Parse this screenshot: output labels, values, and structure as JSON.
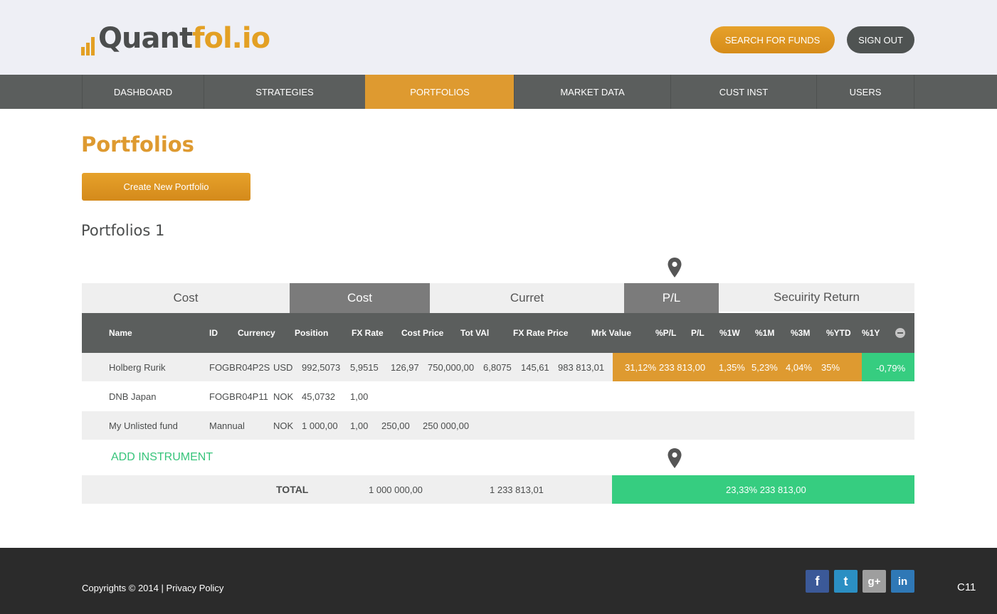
{
  "header": {
    "logo_dark": "Quant",
    "logo_orange": "fol.io",
    "search_button": "SEARCH FOR FUNDS",
    "signout_button": "SIGN OUT"
  },
  "nav": {
    "items": [
      {
        "label": "DASHBOARD"
      },
      {
        "label": "STRATEGIES"
      },
      {
        "label": "PORTFOLIOS"
      },
      {
        "label": "MARKET DATA"
      },
      {
        "label": "CUST INST"
      },
      {
        "label": "USERS"
      }
    ],
    "active": "PORTFOLIOS"
  },
  "page": {
    "title": "Portfolios",
    "create_button": "Create New Portfolio",
    "section_title": "Portfolios 1"
  },
  "groups": [
    "Cost",
    "Cost",
    "Curret",
    "P/L",
    "Secuirity Return"
  ],
  "columns": [
    "Name",
    "ID",
    "Currency",
    "Position",
    "FX Rate",
    "Cost Price",
    "Tot VAl",
    "FX Rate Price",
    "Mrk Value",
    "%P/L",
    "P/L",
    "%1W",
    "%1M",
    "%3M",
    "%YTD",
    "%1Y"
  ],
  "rows": [
    {
      "name": "Holberg Rurik",
      "id": "FOGBR04P2S",
      "currency": "USD",
      "position": "992,5073",
      "fx_rate": "5,9515",
      "cost_price": "126,97",
      "tot_val": "750,000,00",
      "fx_rate_price": "6,8075",
      "price": "145,61",
      "mrk_value": "983 813,01",
      "pct_pl": "31,12%",
      "pl": "233 813,00",
      "pct_1w": "1,35%",
      "pct_1m": "5,23%",
      "pct_3m": "4,04%",
      "pct_ytd": "35%",
      "pct_1y": "-0,79%"
    },
    {
      "name": "DNB Japan",
      "id": "FOGBR04P11",
      "currency": "NOK",
      "position": "45,0732",
      "fx_rate": "1,00"
    },
    {
      "name": "My Unlisted fund",
      "id": "Mannual",
      "currency": "NOK",
      "position": "1 000,00",
      "fx_rate": "1,00",
      "cost_price": "250,00",
      "tot_val": "250 000,00"
    }
  ],
  "add_instrument": "ADD INSTRUMENT",
  "total": {
    "label": "TOTAL",
    "cost": "1 000 000,00",
    "current": "1 233 813,01",
    "pl": "23,33% 233 813,00"
  },
  "footer": {
    "copyright": "Copyrights © 2014 | Privacy Policy",
    "code": "C11",
    "social": [
      {
        "icon": "facebook-icon",
        "glyph": "f",
        "color": "#3b5998"
      },
      {
        "icon": "twitter-icon",
        "glyph": "t",
        "color": "#2b8fc3"
      },
      {
        "icon": "google-plus-icon",
        "glyph": "g+",
        "color": "#9e9e9e"
      },
      {
        "icon": "linkedin-icon",
        "glyph": "in",
        "color": "#2f78b6"
      }
    ]
  },
  "colors": {
    "brand_orange": "#de9a30",
    "dark_grey": "#5b5e5d",
    "green": "#36cd80"
  }
}
